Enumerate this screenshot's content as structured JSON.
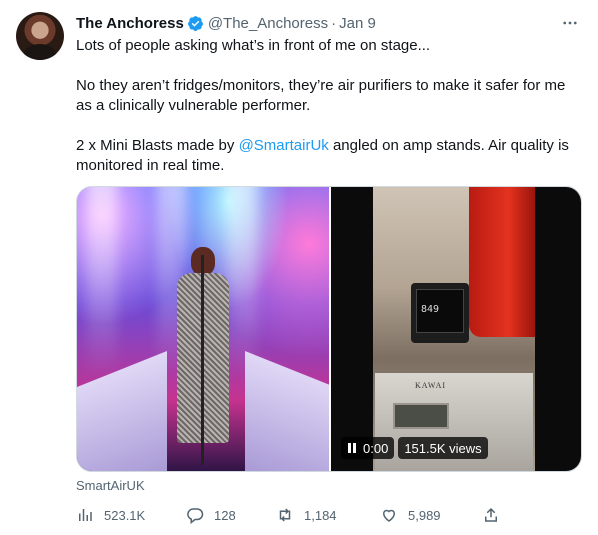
{
  "author": {
    "display_name": "The Anchoress",
    "handle": "@The_Anchoress",
    "separator": "·",
    "date": "Jan 9",
    "verified_icon": "verified-badge-icon"
  },
  "tweet": {
    "line1": "Lots of people asking what’s in front of me on stage...",
    "line2": "No they aren’t fridges/monitors, they’re air purifiers to make it safer for me as a clinically vulnerable performer.",
    "line3_before": "2 x Mini Blasts made by ",
    "line3_mention": "@SmartairUk",
    "line3_after": " angled on amp stands. Air quality is monitored in real time."
  },
  "media": {
    "video_time": "0:00",
    "video_views": "151.5K views",
    "monitor_reading": "849",
    "piano_brand": "KAWAI"
  },
  "source": "SmartAirUK",
  "stats": {
    "views": "523.1K",
    "replies": "128",
    "retweets": "1,184",
    "likes": "5,989"
  },
  "colors": {
    "link": "#1d9bf0",
    "secondary_text": "#536471",
    "primary_text": "#0f1419"
  }
}
